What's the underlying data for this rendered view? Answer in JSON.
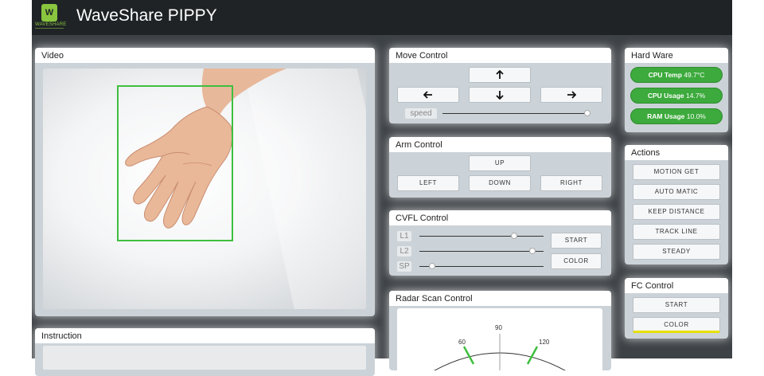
{
  "app": {
    "title": "WaveShare PIPPY",
    "logo_text": "WAVESHARE",
    "logo_mark": "W"
  },
  "video": {
    "title": "Video"
  },
  "instruction": {
    "title": "Instruction"
  },
  "move_control": {
    "title": "Move Control",
    "buttons": {
      "up": "arrow-up-icon",
      "left": "arrow-left-icon",
      "down": "arrow-down-icon",
      "right": "arrow-right-icon"
    },
    "speed_label": "speed",
    "speed_value": 1.0
  },
  "arm_control": {
    "title": "Arm Control",
    "buttons": {
      "up": "UP",
      "left": "LEFT",
      "down": "DOWN",
      "right": "RIGHT"
    }
  },
  "cvfl_control": {
    "title": "CVFL Control",
    "sliders": [
      {
        "label": "L1",
        "value": 0.76
      },
      {
        "label": "L2",
        "value": 0.91
      },
      {
        "label": "SP",
        "value": 0.1
      }
    ],
    "start_label": "START",
    "color_label": "COLOR"
  },
  "radar": {
    "title": "Radar Scan Control",
    "angle_labels": [
      "60",
      "90",
      "120"
    ]
  },
  "hardware": {
    "title": "Hard Ware",
    "stats": [
      {
        "label": "CPU Temp",
        "value": "49.7°C"
      },
      {
        "label": "CPU Usage",
        "value": "14.7%"
      },
      {
        "label": "RAM Usage",
        "value": "10.0%"
      }
    ],
    "status_color": "#3caa3c"
  },
  "actions": {
    "title": "Actions",
    "buttons": [
      "MOTION GET",
      "AUTO MATIC",
      "KEEP DISTANCE",
      "TRACK LINE",
      "STEADY"
    ]
  },
  "fc_control": {
    "title": "FC Control",
    "start_label": "START",
    "color_label": "COLOR",
    "color_underline": "#e8e000"
  }
}
